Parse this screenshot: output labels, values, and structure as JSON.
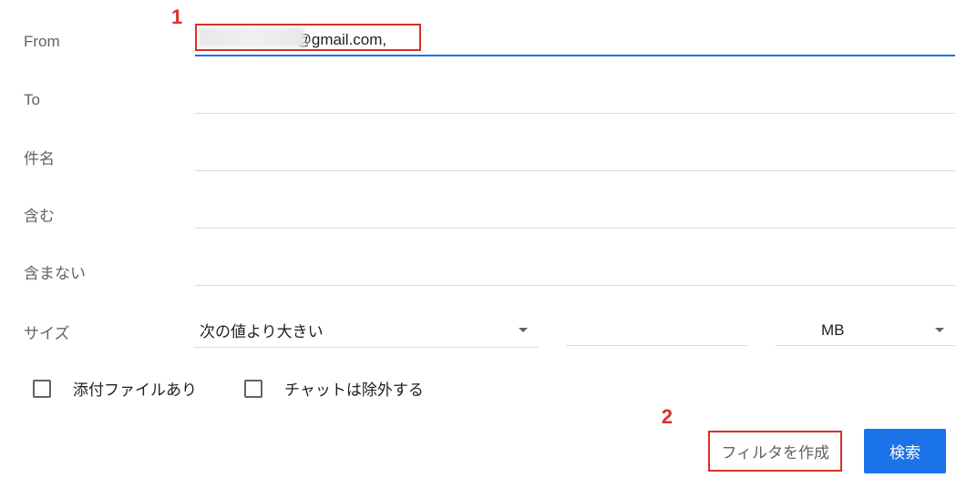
{
  "annotations": {
    "num1": "1",
    "num2": "2"
  },
  "fields": {
    "from": {
      "label": "From",
      "value": "                       @gmail.com,"
    },
    "to": {
      "label": "To",
      "value": ""
    },
    "subject": {
      "label": "件名",
      "value": ""
    },
    "includes": {
      "label": "含む",
      "value": ""
    },
    "excludes": {
      "label": "含まない",
      "value": ""
    }
  },
  "size": {
    "label": "サイズ",
    "comparator": "次の値より大きい",
    "value": "",
    "unit": "MB"
  },
  "checkboxes": {
    "attachment": "添付ファイルあり",
    "excludeChat": "チャットは除外する"
  },
  "buttons": {
    "createFilter": "フィルタを作成",
    "search": "検索"
  }
}
